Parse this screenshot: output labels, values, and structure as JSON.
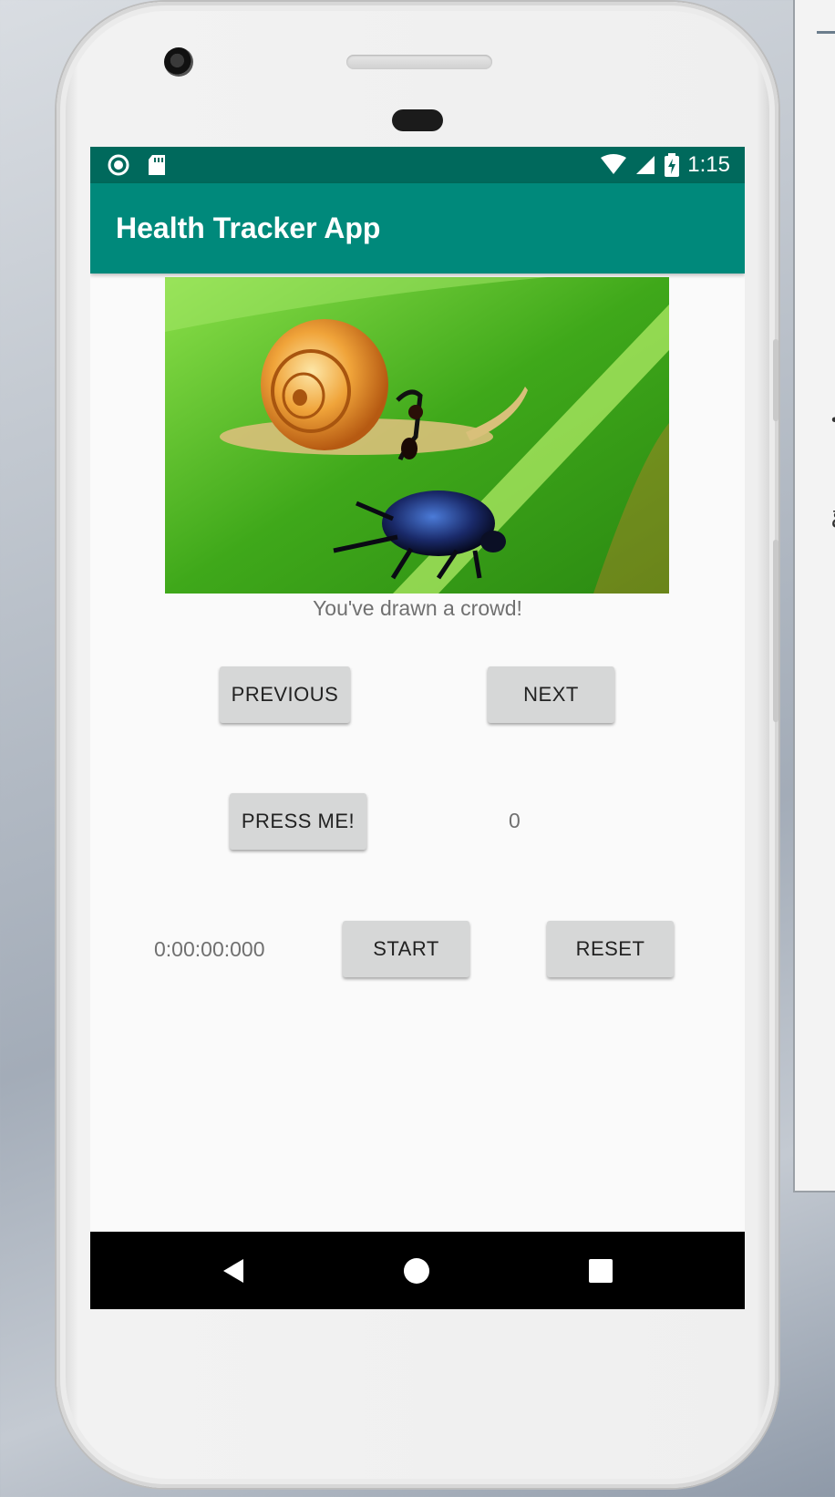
{
  "status_bar": {
    "time": "1:15",
    "left_icons": [
      "sync-circle-icon",
      "sd-card-icon"
    ],
    "right_icons": [
      "wifi-icon",
      "cell-signal-icon",
      "battery-charging-icon"
    ]
  },
  "app_bar": {
    "title": "Health Tracker App"
  },
  "image": {
    "subject": "snail-ant-beetle-photo"
  },
  "caption": "You've drawn a crowd!",
  "nav_buttons": {
    "previous": "PREVIOUS",
    "next": "NEXT"
  },
  "counter_section": {
    "press_label": "PRESS ME!",
    "count": "0"
  },
  "stopwatch": {
    "time": "0:00:00:000",
    "start_label": "START",
    "reset_label": "RESET"
  },
  "system_nav": {
    "back": "back-icon",
    "home": "home-icon",
    "recents": "recents-icon"
  },
  "colors": {
    "status_bar": "#00695c",
    "app_bar": "#00897b",
    "button": "#d6d7d7"
  }
}
